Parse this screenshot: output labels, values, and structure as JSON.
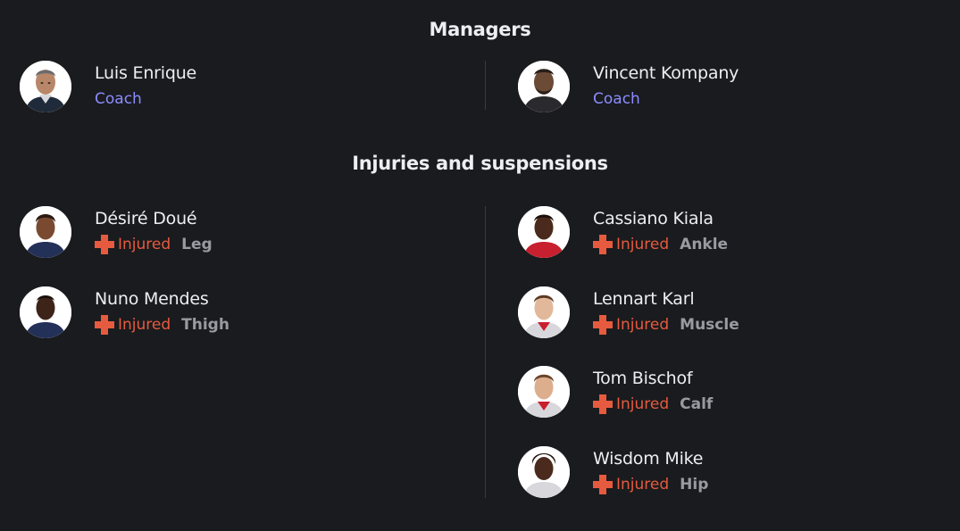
{
  "managers": {
    "title": "Managers",
    "home": {
      "name": "Luis Enrique",
      "role": "Coach",
      "avatar": "manager-avatar"
    },
    "away": {
      "name": "Vincent Kompany",
      "role": "Coach",
      "avatar": "manager-avatar"
    }
  },
  "injuries": {
    "title": "Injuries and suspensions",
    "home": [
      {
        "name": "Désiré Doué",
        "status": "Injured",
        "detail": "Leg"
      },
      {
        "name": "Nuno Mendes",
        "status": "Injured",
        "detail": "Thigh"
      }
    ],
    "away": [
      {
        "name": "Cassiano Kiala",
        "status": "Injured",
        "detail": "Ankle"
      },
      {
        "name": "Lennart Karl",
        "status": "Injured",
        "detail": "Muscle"
      },
      {
        "name": "Tom Bischof",
        "status": "Injured",
        "detail": "Calf"
      },
      {
        "name": "Wisdom Mike",
        "status": "Injured",
        "detail": "Hip"
      }
    ]
  },
  "colors": {
    "background": "#1a1b1e",
    "text": "#eceef2",
    "role": "#8b8cff",
    "injured": "#e65b3f",
    "detail": "#9a9ba0",
    "divider": "#3a3b40"
  },
  "icons": {
    "injury": "red-cross-icon",
    "avatar": "player-photo"
  }
}
